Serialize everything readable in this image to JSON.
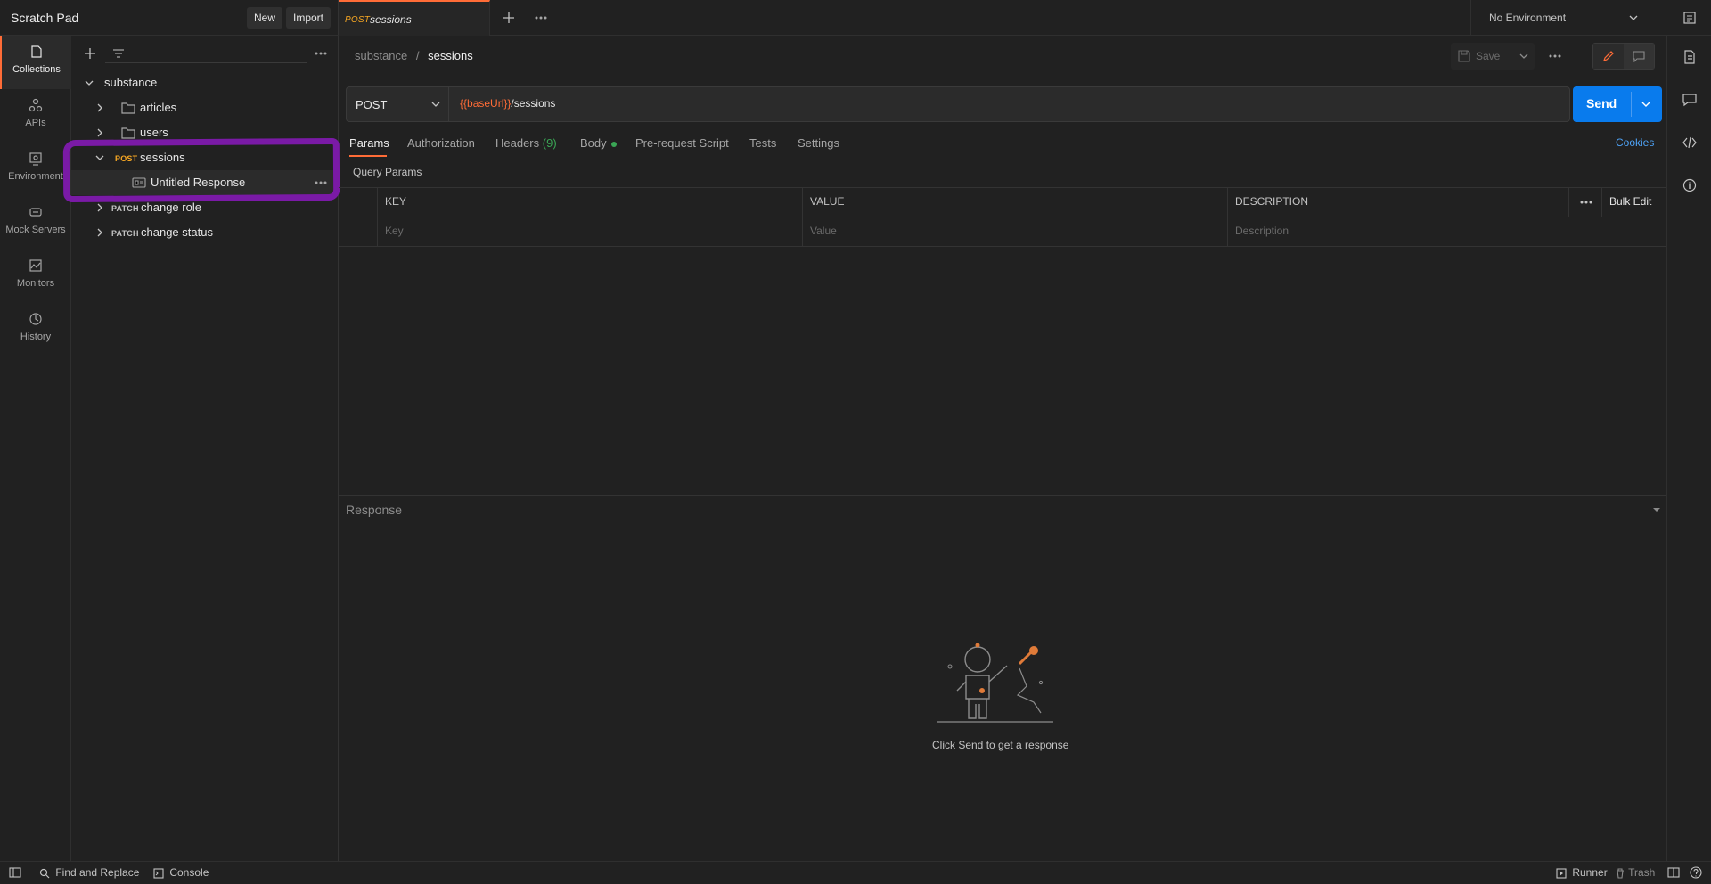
{
  "workspace": {
    "title": "Scratch Pad",
    "new_label": "New",
    "import_label": "Import"
  },
  "rail": [
    {
      "label": "Collections",
      "icon": "collections-icon"
    },
    {
      "label": "APIs",
      "icon": "apis-icon"
    },
    {
      "label": "Environment",
      "icon": "environment-icon"
    },
    {
      "label": "Mock Servers",
      "icon": "mock-servers-icon"
    },
    {
      "label": "Monitors",
      "icon": "monitors-icon"
    },
    {
      "label": "History",
      "icon": "history-icon"
    }
  ],
  "tree": {
    "collection": "substance",
    "folders": [
      "articles",
      "users"
    ],
    "requests": [
      {
        "method": "POST",
        "name": "sessions",
        "expanded": true,
        "example": "Untitled Response"
      },
      {
        "method": "PATCH",
        "name": "change role"
      },
      {
        "method": "PATCH",
        "name": "change status"
      }
    ]
  },
  "tab": {
    "method": "POST",
    "name": "sessions"
  },
  "environment": {
    "selected": "No Environment"
  },
  "breadcrumb": {
    "parent": "substance",
    "separator": "/",
    "current": "sessions"
  },
  "toolbar": {
    "save_label": "Save"
  },
  "request": {
    "method": "POST",
    "url_var": "{{baseUrl}}",
    "url_path": "/sessions",
    "send_label": "Send"
  },
  "subtabs": {
    "params": "Params",
    "authorization": "Authorization",
    "headers": "Headers",
    "headers_count": "(9)",
    "body": "Body",
    "pre_request": "Pre-request Script",
    "tests": "Tests",
    "settings": "Settings",
    "cookies": "Cookies"
  },
  "query_params": {
    "title": "Query Params",
    "columns": [
      "KEY",
      "VALUE",
      "DESCRIPTION"
    ],
    "bulk_edit": "Bulk Edit",
    "placeholders": [
      "Key",
      "Value",
      "Description"
    ]
  },
  "response": {
    "title": "Response",
    "empty_text": "Click Send to get a response"
  },
  "status_bar": {
    "find_replace": "Find and Replace",
    "console": "Console",
    "runner": "Runner",
    "trash": "Trash"
  },
  "colors": {
    "accent": "#ff6c37",
    "send": "#097bed",
    "highlight": "#7a1aa6",
    "post": "#f5a623"
  }
}
